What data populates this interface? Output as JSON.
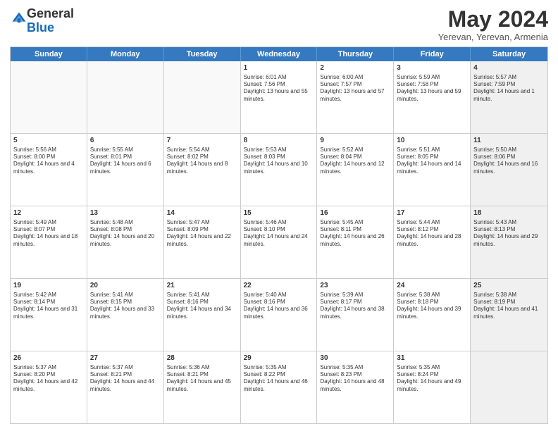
{
  "header": {
    "logo_general": "General",
    "logo_blue": "Blue",
    "month_title": "May 2024",
    "location": "Yerevan, Yerevan, Armenia"
  },
  "days_of_week": [
    "Sunday",
    "Monday",
    "Tuesday",
    "Wednesday",
    "Thursday",
    "Friday",
    "Saturday"
  ],
  "weeks": [
    {
      "cells": [
        {
          "day": "",
          "empty": true
        },
        {
          "day": "",
          "empty": true
        },
        {
          "day": "",
          "empty": true
        },
        {
          "day": "1",
          "sunrise": "Sunrise: 6:01 AM",
          "sunset": "Sunset: 7:56 PM",
          "daylight": "Daylight: 13 hours and 55 minutes."
        },
        {
          "day": "2",
          "sunrise": "Sunrise: 6:00 AM",
          "sunset": "Sunset: 7:57 PM",
          "daylight": "Daylight: 13 hours and 57 minutes."
        },
        {
          "day": "3",
          "sunrise": "Sunrise: 5:59 AM",
          "sunset": "Sunset: 7:58 PM",
          "daylight": "Daylight: 13 hours and 59 minutes."
        },
        {
          "day": "4",
          "sunrise": "Sunrise: 5:57 AM",
          "sunset": "Sunset: 7:59 PM",
          "daylight": "Daylight: 14 hours and 1 minute.",
          "shaded": true
        }
      ]
    },
    {
      "cells": [
        {
          "day": "5",
          "sunrise": "Sunrise: 5:56 AM",
          "sunset": "Sunset: 8:00 PM",
          "daylight": "Daylight: 14 hours and 4 minutes."
        },
        {
          "day": "6",
          "sunrise": "Sunrise: 5:55 AM",
          "sunset": "Sunset: 8:01 PM",
          "daylight": "Daylight: 14 hours and 6 minutes."
        },
        {
          "day": "7",
          "sunrise": "Sunrise: 5:54 AM",
          "sunset": "Sunset: 8:02 PM",
          "daylight": "Daylight: 14 hours and 8 minutes."
        },
        {
          "day": "8",
          "sunrise": "Sunrise: 5:53 AM",
          "sunset": "Sunset: 8:03 PM",
          "daylight": "Daylight: 14 hours and 10 minutes."
        },
        {
          "day": "9",
          "sunrise": "Sunrise: 5:52 AM",
          "sunset": "Sunset: 8:04 PM",
          "daylight": "Daylight: 14 hours and 12 minutes."
        },
        {
          "day": "10",
          "sunrise": "Sunrise: 5:51 AM",
          "sunset": "Sunset: 8:05 PM",
          "daylight": "Daylight: 14 hours and 14 minutes."
        },
        {
          "day": "11",
          "sunrise": "Sunrise: 5:50 AM",
          "sunset": "Sunset: 8:06 PM",
          "daylight": "Daylight: 14 hours and 16 minutes.",
          "shaded": true
        }
      ]
    },
    {
      "cells": [
        {
          "day": "12",
          "sunrise": "Sunrise: 5:49 AM",
          "sunset": "Sunset: 8:07 PM",
          "daylight": "Daylight: 14 hours and 18 minutes."
        },
        {
          "day": "13",
          "sunrise": "Sunrise: 5:48 AM",
          "sunset": "Sunset: 8:08 PM",
          "daylight": "Daylight: 14 hours and 20 minutes."
        },
        {
          "day": "14",
          "sunrise": "Sunrise: 5:47 AM",
          "sunset": "Sunset: 8:09 PM",
          "daylight": "Daylight: 14 hours and 22 minutes."
        },
        {
          "day": "15",
          "sunrise": "Sunrise: 5:46 AM",
          "sunset": "Sunset: 8:10 PM",
          "daylight": "Daylight: 14 hours and 24 minutes."
        },
        {
          "day": "16",
          "sunrise": "Sunrise: 5:45 AM",
          "sunset": "Sunset: 8:11 PM",
          "daylight": "Daylight: 14 hours and 26 minutes."
        },
        {
          "day": "17",
          "sunrise": "Sunrise: 5:44 AM",
          "sunset": "Sunset: 8:12 PM",
          "daylight": "Daylight: 14 hours and 28 minutes."
        },
        {
          "day": "18",
          "sunrise": "Sunrise: 5:43 AM",
          "sunset": "Sunset: 8:13 PM",
          "daylight": "Daylight: 14 hours and 29 minutes.",
          "shaded": true
        }
      ]
    },
    {
      "cells": [
        {
          "day": "19",
          "sunrise": "Sunrise: 5:42 AM",
          "sunset": "Sunset: 8:14 PM",
          "daylight": "Daylight: 14 hours and 31 minutes."
        },
        {
          "day": "20",
          "sunrise": "Sunrise: 5:41 AM",
          "sunset": "Sunset: 8:15 PM",
          "daylight": "Daylight: 14 hours and 33 minutes."
        },
        {
          "day": "21",
          "sunrise": "Sunrise: 5:41 AM",
          "sunset": "Sunset: 8:16 PM",
          "daylight": "Daylight: 14 hours and 34 minutes."
        },
        {
          "day": "22",
          "sunrise": "Sunrise: 5:40 AM",
          "sunset": "Sunset: 8:16 PM",
          "daylight": "Daylight: 14 hours and 36 minutes."
        },
        {
          "day": "23",
          "sunrise": "Sunrise: 5:39 AM",
          "sunset": "Sunset: 8:17 PM",
          "daylight": "Daylight: 14 hours and 38 minutes."
        },
        {
          "day": "24",
          "sunrise": "Sunrise: 5:38 AM",
          "sunset": "Sunset: 8:18 PM",
          "daylight": "Daylight: 14 hours and 39 minutes."
        },
        {
          "day": "25",
          "sunrise": "Sunrise: 5:38 AM",
          "sunset": "Sunset: 8:19 PM",
          "daylight": "Daylight: 14 hours and 41 minutes.",
          "shaded": true
        }
      ]
    },
    {
      "cells": [
        {
          "day": "26",
          "sunrise": "Sunrise: 5:37 AM",
          "sunset": "Sunset: 8:20 PM",
          "daylight": "Daylight: 14 hours and 42 minutes."
        },
        {
          "day": "27",
          "sunrise": "Sunrise: 5:37 AM",
          "sunset": "Sunset: 8:21 PM",
          "daylight": "Daylight: 14 hours and 44 minutes."
        },
        {
          "day": "28",
          "sunrise": "Sunrise: 5:36 AM",
          "sunset": "Sunset: 8:21 PM",
          "daylight": "Daylight: 14 hours and 45 minutes."
        },
        {
          "day": "29",
          "sunrise": "Sunrise: 5:35 AM",
          "sunset": "Sunset: 8:22 PM",
          "daylight": "Daylight: 14 hours and 46 minutes."
        },
        {
          "day": "30",
          "sunrise": "Sunrise: 5:35 AM",
          "sunset": "Sunset: 8:23 PM",
          "daylight": "Daylight: 14 hours and 48 minutes."
        },
        {
          "day": "31",
          "sunrise": "Sunrise: 5:35 AM",
          "sunset": "Sunset: 8:24 PM",
          "daylight": "Daylight: 14 hours and 49 minutes."
        },
        {
          "day": "",
          "empty": true,
          "shaded": true
        }
      ]
    }
  ]
}
